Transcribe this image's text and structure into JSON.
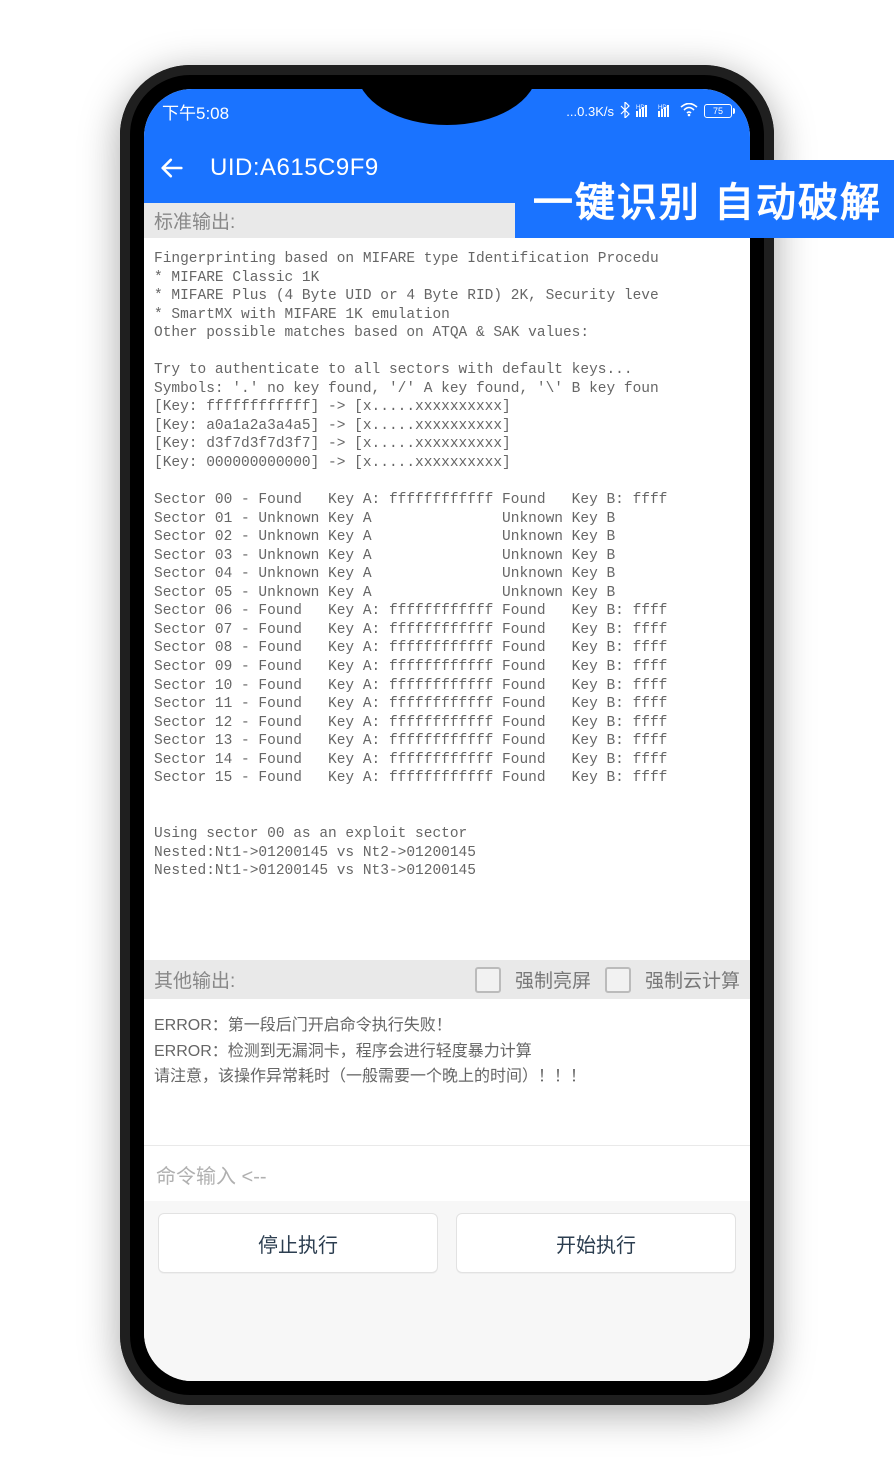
{
  "status": {
    "time": "下午5:08",
    "net_speed": "...0.3K/s",
    "battery_label": "75"
  },
  "appbar": {
    "title": "UID:A615C9F9"
  },
  "overlay": {
    "text": "一键识别 自动破解"
  },
  "section_std_label": "标准输出:",
  "std_output": "Fingerprinting based on MIFARE type Identification Procedu\n* MIFARE Classic 1K\n* MIFARE Plus (4 Byte UID or 4 Byte RID) 2K, Security leve\n* SmartMX with MIFARE 1K emulation\nOther possible matches based on ATQA & SAK values:\n\nTry to authenticate to all sectors with default keys...\nSymbols: '.' no key found, '/' A key found, '\\' B key foun\n[Key: ffffffffffff] -> [x.....xxxxxxxxxx]\n[Key: a0a1a2a3a4a5] -> [x.....xxxxxxxxxx]\n[Key: d3f7d3f7d3f7] -> [x.....xxxxxxxxxx]\n[Key: 000000000000] -> [x.....xxxxxxxxxx]\n\nSector 00 - Found   Key A: ffffffffffff Found   Key B: ffff\nSector 01 - Unknown Key A               Unknown Key B\nSector 02 - Unknown Key A               Unknown Key B\nSector 03 - Unknown Key A               Unknown Key B\nSector 04 - Unknown Key A               Unknown Key B\nSector 05 - Unknown Key A               Unknown Key B\nSector 06 - Found   Key A: ffffffffffff Found   Key B: ffff\nSector 07 - Found   Key A: ffffffffffff Found   Key B: ffff\nSector 08 - Found   Key A: ffffffffffff Found   Key B: ffff\nSector 09 - Found   Key A: ffffffffffff Found   Key B: ffff\nSector 10 - Found   Key A: ffffffffffff Found   Key B: ffff\nSector 11 - Found   Key A: ffffffffffff Found   Key B: ffff\nSector 12 - Found   Key A: ffffffffffff Found   Key B: ffff\nSector 13 - Found   Key A: ffffffffffff Found   Key B: ffff\nSector 14 - Found   Key A: ffffffffffff Found   Key B: ffff\nSector 15 - Found   Key A: ffffffffffff Found   Key B: ffff\n\n\nUsing sector 00 as an exploit sector\nNested:Nt1->01200145 vs Nt2->01200145\nNested:Nt1->01200145 vs Nt3->01200145",
  "other_bar": {
    "label": "其他输出:",
    "check1_label": "强制亮屏",
    "check2_label": "强制云计算"
  },
  "err_output": {
    "line1_prefix": "ERROR：",
    "line1_text": "第一段后门开启命令执行失败！",
    "line2_prefix": "ERROR：",
    "line2_text": "检测到无漏洞卡，程序会进行轻度暴力计算",
    "line3_text": "请注意，该操作异常耗时（一般需要一个晚上的时间）！！！"
  },
  "cmd_placeholder": "命令输入 <--",
  "buttons": {
    "stop": "停止执行",
    "start": "开始执行"
  }
}
